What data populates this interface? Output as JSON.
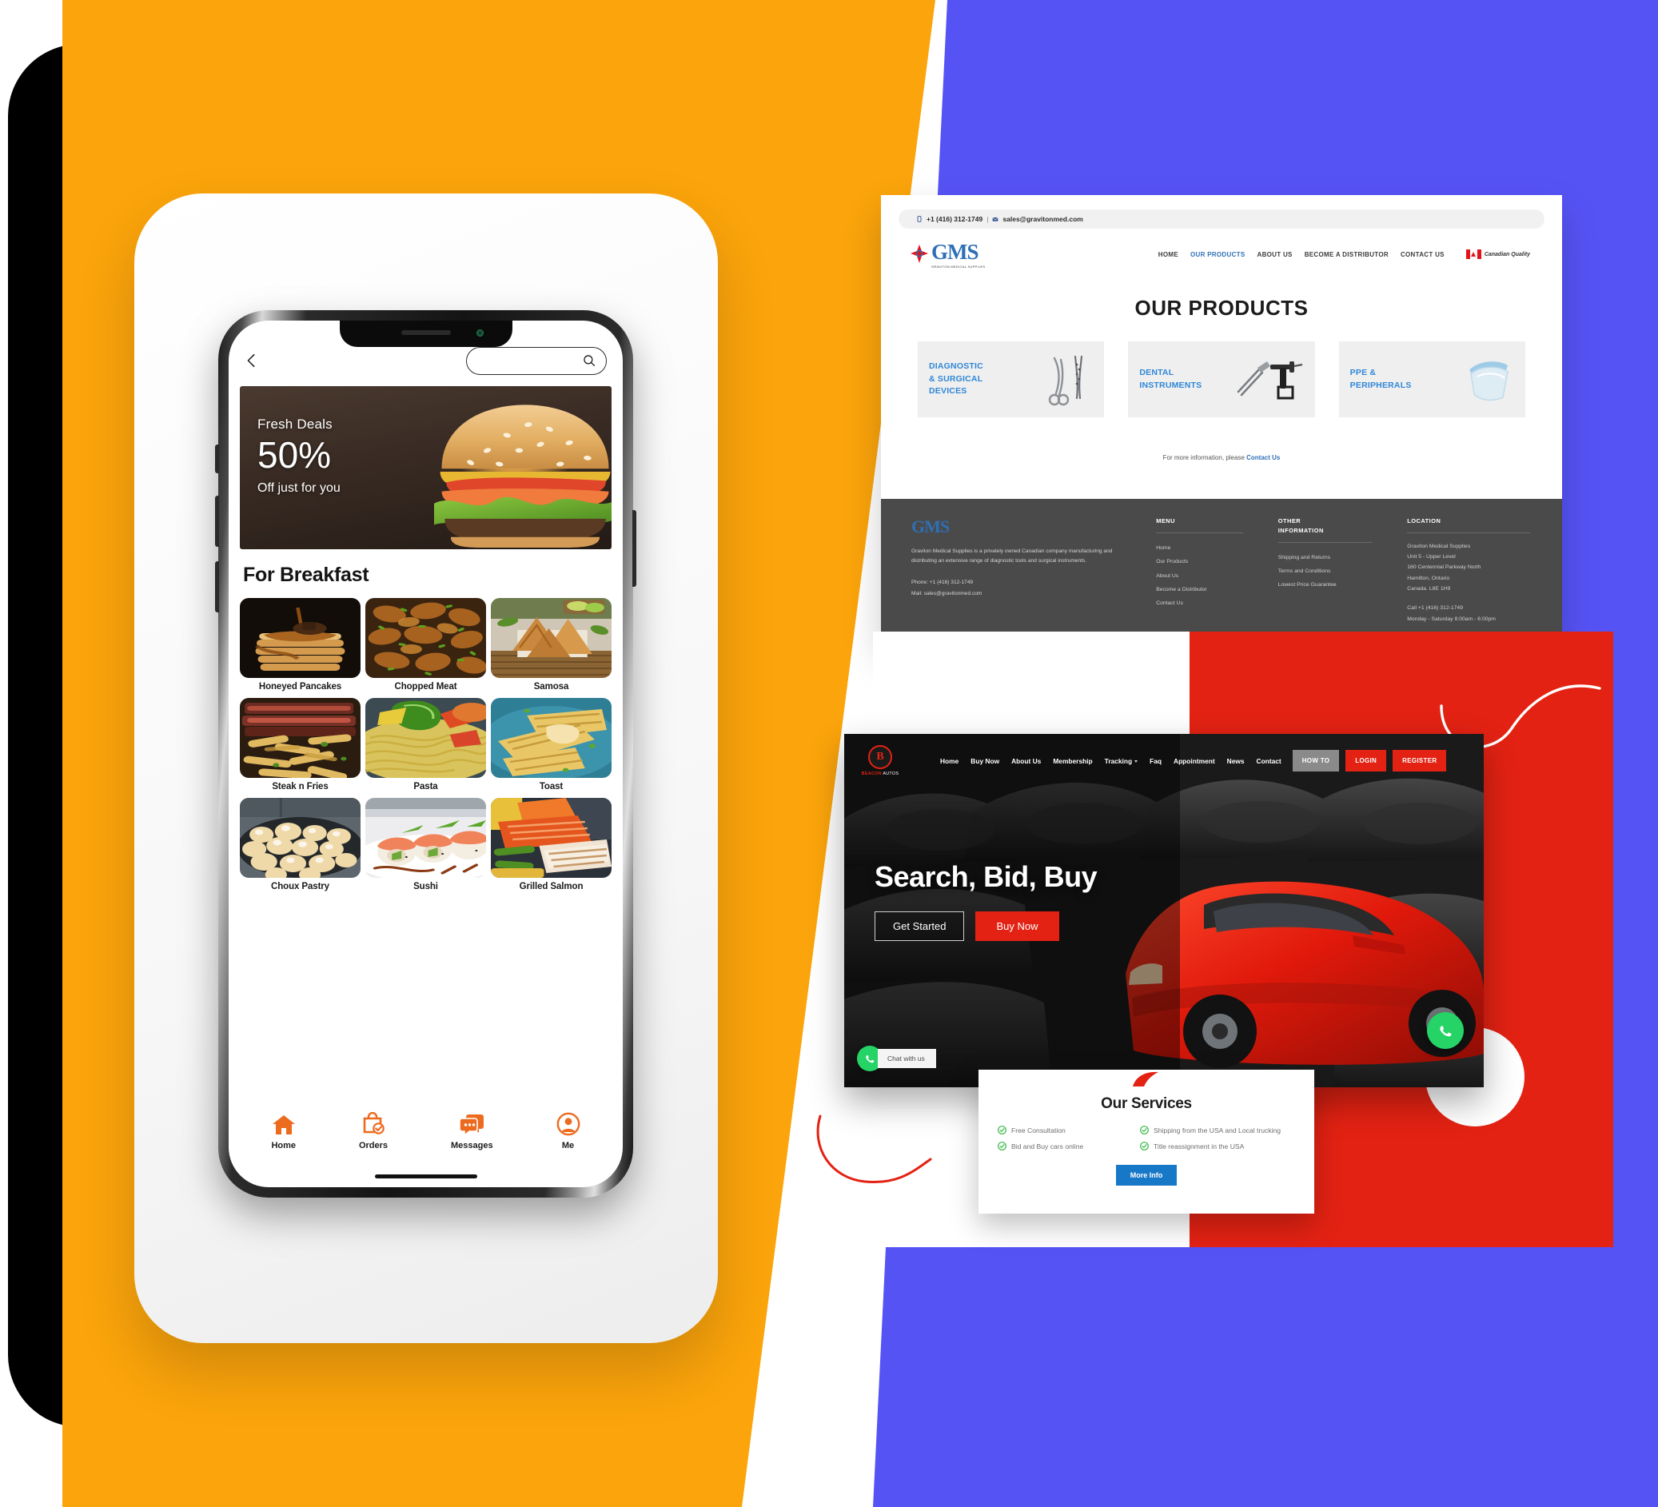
{
  "canvas": {
    "palette": {
      "orange": "#FBA40B",
      "blue": "#5653F5",
      "red": "#E32213",
      "black": "#000000",
      "white": "#FFFFFF",
      "app_accent": "#ED6B1F",
      "gms_blue": "#2F6FB5",
      "services_blue": "#1878C8",
      "whatsapp_green": "#25D366"
    }
  },
  "phone_app": {
    "header": {
      "back_icon": "chevron-left-icon",
      "search_icon": "search-icon",
      "search_placeholder": ""
    },
    "hero": {
      "label": "Fresh Deals",
      "percent": "50%",
      "sub": "Off just for you",
      "image": "cheeseburger-photo"
    },
    "section_title": "For Breakfast",
    "food_items": [
      {
        "label": "Honeyed Pancakes",
        "image": "pancakes-photo"
      },
      {
        "label": "Chopped Meat",
        "image": "chopped-meat-photo"
      },
      {
        "label": "Samosa",
        "image": "samosa-photo"
      },
      {
        "label": "Steak n Fries",
        "image": "steak-fries-photo"
      },
      {
        "label": "Pasta",
        "image": "pasta-photo"
      },
      {
        "label": "Toast",
        "image": "toast-photo"
      },
      {
        "label": "Choux Pastry",
        "image": "choux-pastry-photo"
      },
      {
        "label": "Sushi",
        "image": "sushi-photo"
      },
      {
        "label": "Grilled Salmon",
        "image": "grilled-salmon-photo"
      }
    ],
    "tabbar": [
      {
        "label": "Home",
        "icon": "home-icon"
      },
      {
        "label": "Orders",
        "icon": "shopping-bag-check-icon"
      },
      {
        "label": "Messages",
        "icon": "chat-bubbles-icon"
      },
      {
        "label": "Me",
        "icon": "user-circle-icon"
      }
    ]
  },
  "gms_site": {
    "topbar": {
      "phone_icon": "phone-icon",
      "phone": "+1 (416) 312-1749",
      "separator": "|",
      "mail_icon": "mail-icon",
      "email": "sales@gravitonmed.com"
    },
    "logo": {
      "text": "GMS",
      "sub": "GRAVITON MEDICAL SUPPLIES",
      "icon": "gms-cross-icon"
    },
    "nav": [
      {
        "label": "HOME",
        "active": false
      },
      {
        "label": "OUR PRODUCTS",
        "active": true
      },
      {
        "label": "ABOUT US",
        "active": false
      },
      {
        "label": "BECOME A DISTRIBUTOR",
        "active": false
      },
      {
        "label": "CONTACT US",
        "active": false
      }
    ],
    "flag_badge": {
      "icon": "canada-flag-icon",
      "label": "Canadian Quality"
    },
    "heading": "OUR PRODUCTS",
    "products": [
      {
        "title": "DIAGNOSTIC\n& SURGICAL\nDEVICES",
        "line1": "DIAGNOSTIC",
        "line2": "& SURGICAL",
        "line3": "DEVICES",
        "image": "surgical-scissors-forceps-photo"
      },
      {
        "title": "DENTAL INSTRUMENTS",
        "line1": "DENTAL",
        "line2": "INSTRUMENTS",
        "line3": "",
        "image": "dental-instruments-photo"
      },
      {
        "title": "PPE & PERIPHERALS",
        "line1": "PPE &",
        "line2": "PERIPHERALS",
        "line3": "",
        "image": "face-shield-photo"
      }
    ],
    "more_info_text": "For more information, please ",
    "more_info_link": "Contact Us",
    "footer": {
      "logo": "GMS",
      "description": "Graviton Medical Supplies is a privately owned Canadian company manufacturing and distributing an extensive range of diagnostic tools and surgical instruments.",
      "phone_line": "Phone: +1 (416) 312-1749",
      "mail_line": "Mail: sales@gravitonmed.com",
      "menu_head": "MENU",
      "menu_links": [
        "Home",
        "Our Products",
        "About Us",
        "Become a Distributor",
        "Contact Us"
      ],
      "other_head_l1": "OTHER",
      "other_head_l2": "INFORMATION",
      "other_links": [
        "Shipping and Returns",
        "Terms and Conditions",
        "Lowest Price Guarantee"
      ],
      "location_head": "LOCATION",
      "address": [
        "Graviton Medical Supplies",
        "Unit 5 - Upper Level",
        "160 Centennial Parkway North",
        "Hamilton, Ontario",
        "Canada. L8E 1H9"
      ],
      "call": "Call +1 (416) 312-1749",
      "hours": "Monday - Saturday 8:00am - 6:00pm"
    }
  },
  "car_site": {
    "logo": {
      "mark": "B",
      "name_1": "BEACON",
      "name_2": " AUTOS"
    },
    "nav": [
      {
        "label": "Home",
        "caret": false
      },
      {
        "label": "Buy Now",
        "caret": false
      },
      {
        "label": "About Us",
        "caret": false
      },
      {
        "label": "Membership",
        "caret": false
      },
      {
        "label": "Tracking",
        "caret": true
      },
      {
        "label": "Faq",
        "caret": false
      },
      {
        "label": "Appointment",
        "caret": false
      },
      {
        "label": "News",
        "caret": false
      },
      {
        "label": "Contact",
        "caret": false
      }
    ],
    "buttons": [
      {
        "label": "HOW TO",
        "style": "grey"
      },
      {
        "label": "LOGIN",
        "style": "red"
      },
      {
        "label": "REGISTER",
        "style": "red"
      }
    ],
    "hero": {
      "headline": "Search, Bid, Buy",
      "cta_outline": "Get Started",
      "cta_solid": "Buy Now",
      "image": "red-sedan-in-dark-car-lot-photo"
    },
    "whatsapp": {
      "icon": "whatsapp-icon",
      "label": "Chat with us"
    },
    "services": {
      "logo_icon": "beacon-swoosh-icon",
      "title": "Our Services",
      "items": [
        "Free Consultation",
        "Shipping from the USA and Local trucking",
        "Bid and Buy cars online",
        "Title reassignment in the USA"
      ],
      "button": "More Info"
    }
  }
}
